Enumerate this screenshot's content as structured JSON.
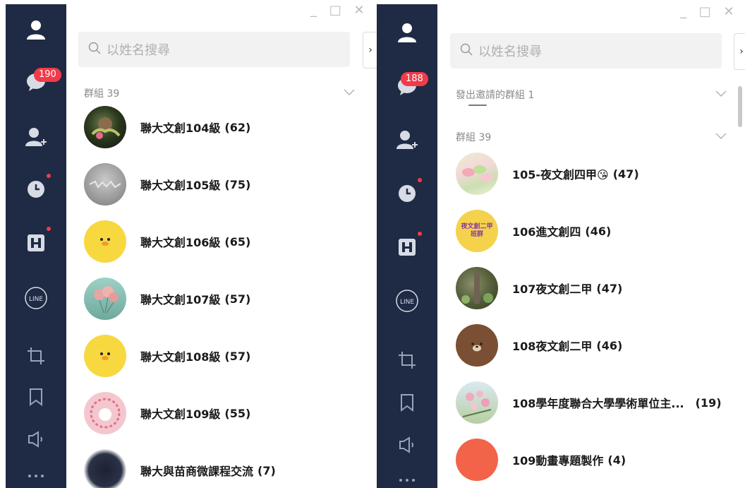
{
  "left": {
    "unread_badge": "190",
    "search_placeholder": "以姓名搜尋",
    "section_label": "群組 39",
    "groups": [
      {
        "name": "聯大文創104級",
        "count": "(62)"
      },
      {
        "name": "聯大文創105級",
        "count": "(75)"
      },
      {
        "name": "聯大文創106級",
        "count": "(65)"
      },
      {
        "name": "聯大文創107級",
        "count": "(57)"
      },
      {
        "name": "聯大文創108級",
        "count": "(57)"
      },
      {
        "name": "聯大文創109級",
        "count": "(55)"
      },
      {
        "name": "聯大與苗商微課程交流",
        "count": "(7)"
      }
    ]
  },
  "right": {
    "unread_badge": "188",
    "search_placeholder": "以姓名搜尋",
    "invited_label": "發出邀請的群組 1",
    "section_label": "群組 39",
    "groups": [
      {
        "name": "105-夜文創四甲😘",
        "count": "(47)"
      },
      {
        "name": "106進文創四",
        "count": "(46)"
      },
      {
        "name": "107夜文創二甲",
        "count": "(47)"
      },
      {
        "name": "108夜文創二甲",
        "count": "(46)"
      },
      {
        "name": "108學年度聯合大學學術單位主...",
        "count": "(19)"
      },
      {
        "name": "109動畫專題製作",
        "count": "(4)"
      }
    ],
    "avatar_text_106": "夜文創二甲\n班群"
  },
  "sidebar_icons": [
    "profile-icon",
    "chat-icon",
    "add-friend-icon",
    "clock-icon",
    "h-app-icon",
    "line-icon",
    "crop-icon",
    "bookmark-icon",
    "speaker-icon",
    "more-icon"
  ],
  "window_controls": {
    "minimize": "_",
    "maximize": "□",
    "close": "✕"
  },
  "colors": {
    "sidebar": "#1f2a44",
    "badge": "#f23b4a",
    "search_bg": "#f2f2f3"
  }
}
